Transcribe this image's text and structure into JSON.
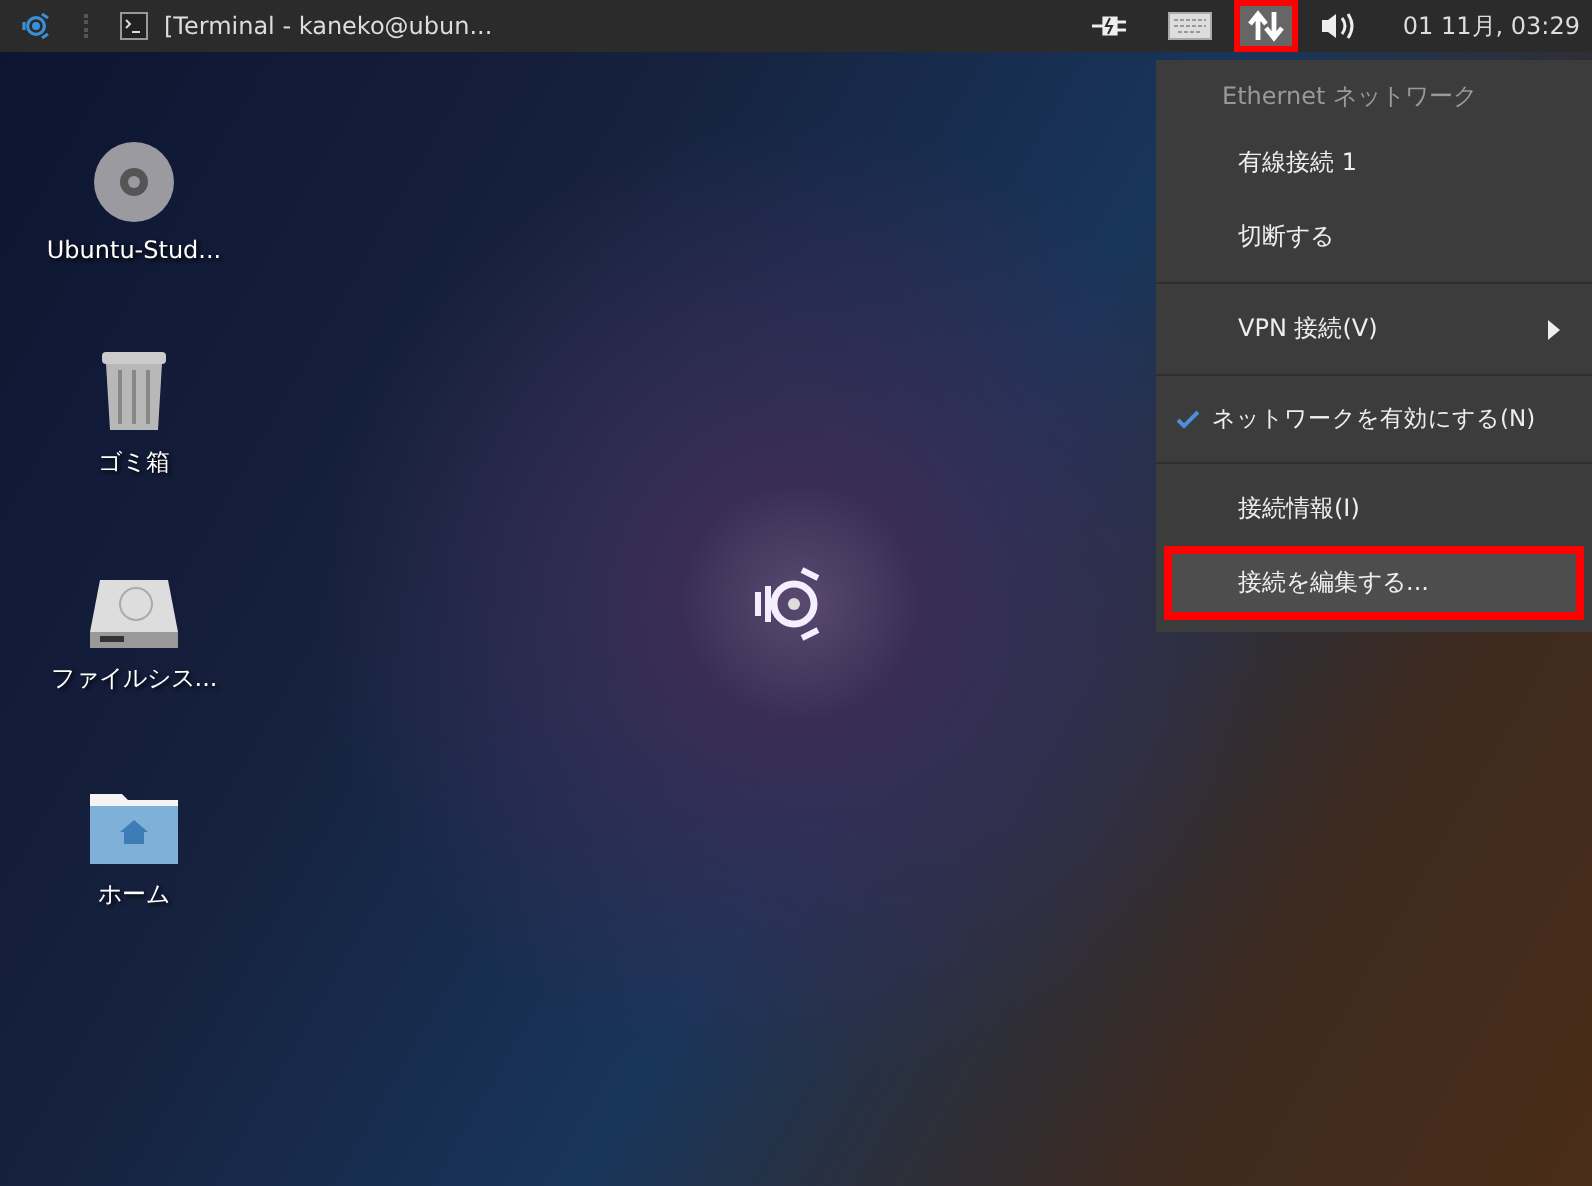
{
  "panel": {
    "window_button": {
      "title": "[Terminal - kaneko@ubun..."
    },
    "tray": [
      {
        "kind": "power",
        "selected": false,
        "annotated": false
      },
      {
        "kind": "keyboard",
        "selected": false,
        "annotated": false
      },
      {
        "kind": "network",
        "selected": true,
        "annotated": true
      },
      {
        "kind": "volume",
        "selected": false,
        "annotated": false
      }
    ],
    "clock": "01 11月, 03:29"
  },
  "desktop_icons": [
    {
      "kind": "disc",
      "label": "Ubuntu-Stud..."
    },
    {
      "kind": "trash",
      "label": "ゴミ箱"
    },
    {
      "kind": "drive",
      "label": "ファイルシス..."
    },
    {
      "kind": "home",
      "label": "ホーム"
    }
  ],
  "network_menu": {
    "items": [
      {
        "kind": "header",
        "label": "Ethernet ネットワーク"
      },
      {
        "kind": "item",
        "label": "有線接続 1",
        "highlighted": false,
        "annotated": false
      },
      {
        "kind": "item",
        "label": "切断する",
        "highlighted": false,
        "annotated": false
      },
      {
        "kind": "separator"
      },
      {
        "kind": "submenu",
        "label": "VPN 接続(V)"
      },
      {
        "kind": "separator"
      },
      {
        "kind": "check",
        "label": "ネットワークを有効にする(N)",
        "checked": true
      },
      {
        "kind": "separator"
      },
      {
        "kind": "item",
        "label": "接続情報(I)",
        "highlighted": false,
        "annotated": false
      },
      {
        "kind": "item",
        "label": "接続を編集する...",
        "highlighted": true,
        "annotated": true
      }
    ]
  }
}
